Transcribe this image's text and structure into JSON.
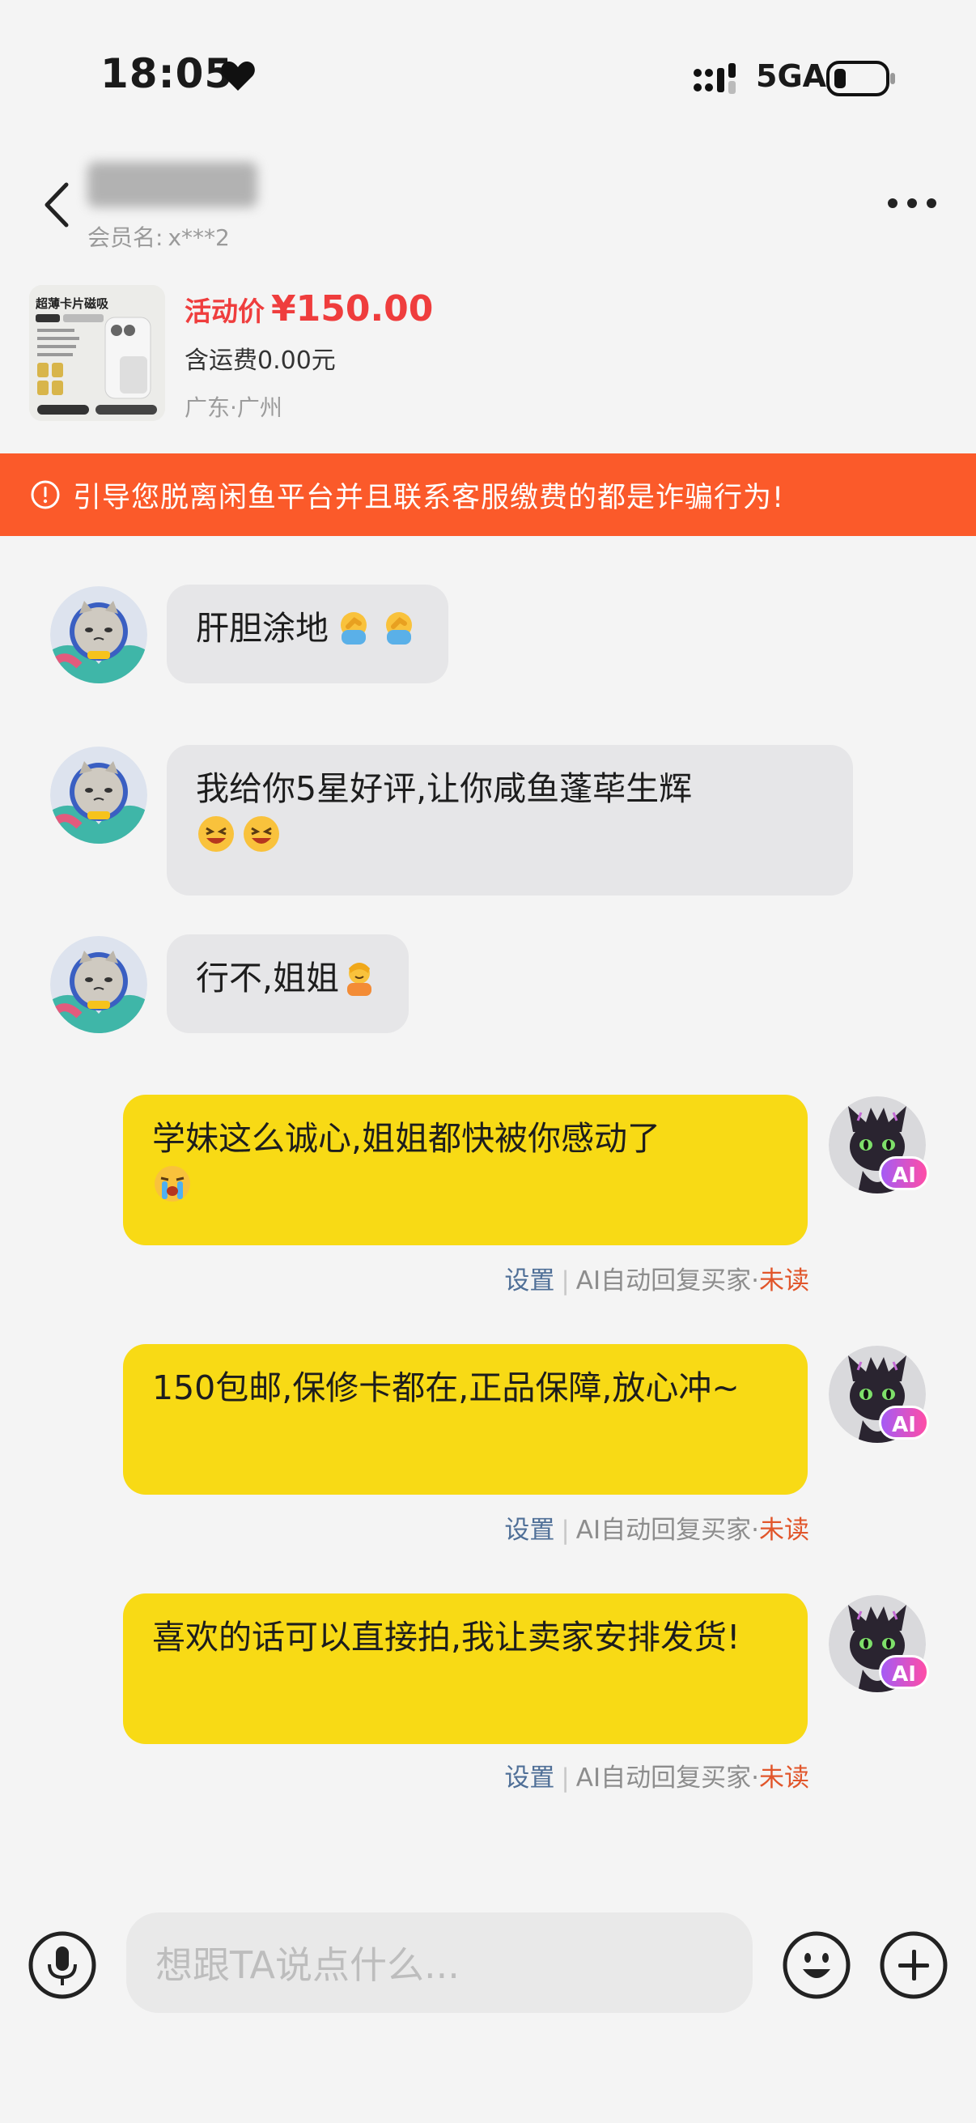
{
  "status_bar": {
    "time": "18:05",
    "network": "5GA"
  },
  "header": {
    "member_label": "会员名:",
    "member_value": "x***2",
    "title_blurred": "",
    "back_icon": "chevron-left-icon",
    "more_icon": "more-dots-icon"
  },
  "product": {
    "price_label": "活动价",
    "price": "¥150.00",
    "shipping": "含运费0.00元",
    "location": "广东·广州",
    "thumb_title": "超薄卡片磁吸",
    "price_color": "#ef3d3d"
  },
  "warning": {
    "text": "引导您脱离闲鱼平台并且联系客服缴费的都是诈骗行为!",
    "color": "#fb5a2a"
  },
  "messages": [
    {
      "side": "in",
      "text": "肝胆涂地",
      "emoji": [
        "facepalm",
        "facepalm"
      ]
    },
    {
      "side": "in",
      "text": "我给你5星好评,让你咸鱼蓬荜生辉",
      "emoji": [
        "laugh",
        "laugh"
      ]
    },
    {
      "side": "in",
      "text": "行不,姐姐",
      "emoji": [
        "pray"
      ]
    },
    {
      "side": "out",
      "text": "学妹这么诚心,姐姐都快被你感动了",
      "emoji": [
        "cry"
      ],
      "meta": {
        "settings": "设置",
        "auto": "AI自动回复买家·",
        "status": "未读"
      }
    },
    {
      "side": "out",
      "text": "150包邮,保修卡都在,正品保障,放心冲~",
      "emoji": [],
      "meta": {
        "settings": "设置",
        "auto": "AI自动回复买家·",
        "status": "未读"
      }
    },
    {
      "side": "out",
      "text": "喜欢的话可以直接拍,我让卖家安排发货!",
      "emoji": [],
      "meta": {
        "settings": "设置",
        "auto": "AI自动回复买家·",
        "status": "未读"
      }
    }
  ],
  "ai_badge": "AI",
  "input": {
    "placeholder": "想跟TA说点什么...",
    "voice_icon": "microphone-icon",
    "emoji_icon": "smiley-icon",
    "plus_icon": "plus-icon"
  },
  "colors": {
    "outgoing_bubble": "#f8da15",
    "incoming_bubble": "#e6e6e8",
    "unread": "#e1562b",
    "settings_link": "#4f6f97"
  }
}
